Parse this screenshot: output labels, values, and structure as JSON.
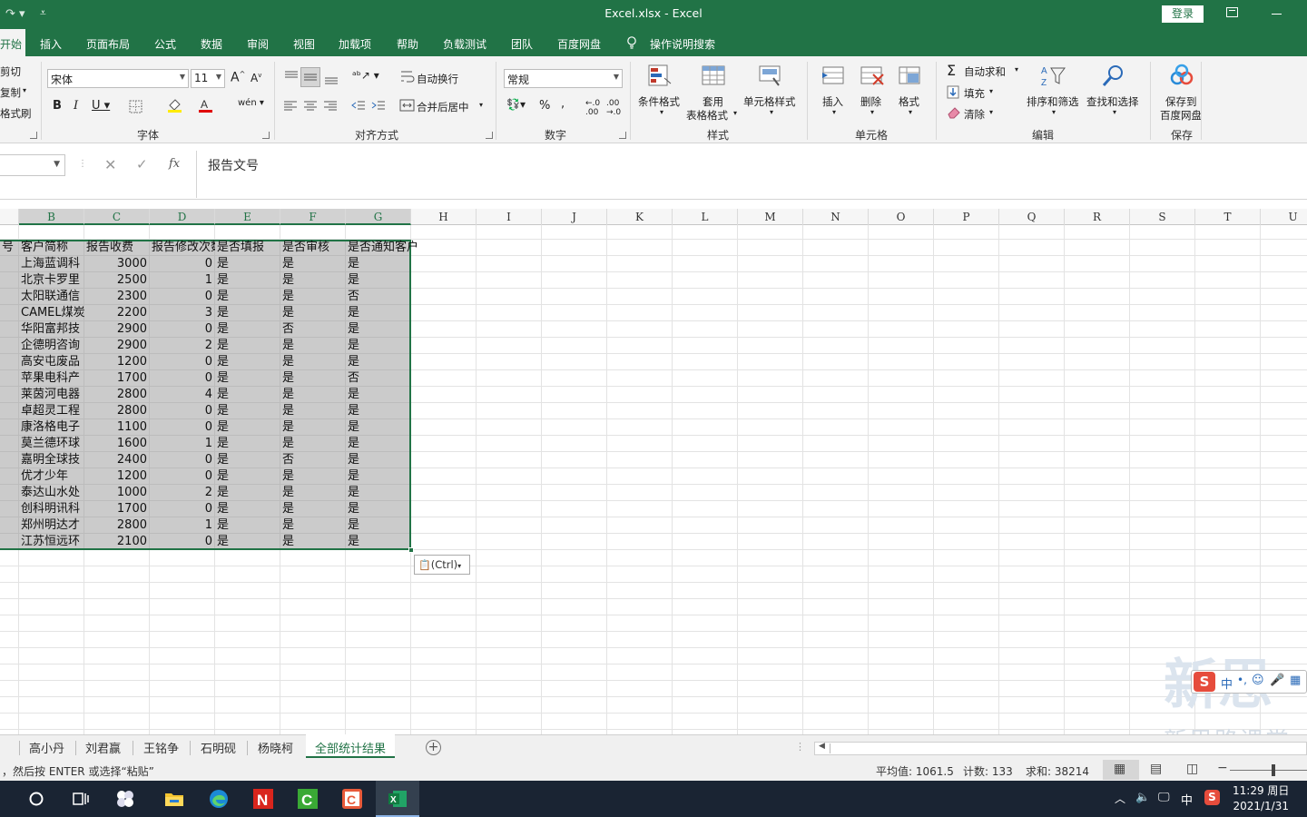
{
  "titlebar": {
    "title": "Excel.xlsx  -  Excel",
    "login_label": "登录"
  },
  "tabs": [
    "开始",
    "插入",
    "页面布局",
    "公式",
    "数据",
    "审阅",
    "视图",
    "加载项",
    "帮助",
    "负载测试",
    "团队",
    "百度网盘"
  ],
  "tell_me": "操作说明搜索",
  "ribbon": {
    "clipboard": {
      "cut": "剪切",
      "copy": "复制",
      "format_painter": "格式刷"
    },
    "font": {
      "name": "宋体",
      "size": "11",
      "group_label": "字体"
    },
    "alignment": {
      "wrap_text": "自动换行",
      "merge_center": "合并后居中",
      "group_label": "对齐方式"
    },
    "number": {
      "format": "常规",
      "group_label": "数字"
    },
    "styles": {
      "conditional": "条件格式",
      "table_line1": "套用",
      "table_line2": "表格格式",
      "cell_styles": "单元格样式",
      "group_label": "样式"
    },
    "cells": {
      "insert": "插入",
      "delete": "删除",
      "format": "格式",
      "group_label": "单元格"
    },
    "editing": {
      "autosum": "自动求和",
      "fill": "填充",
      "clear": "清除",
      "sort_filter": "排序和筛选",
      "find_select": "查找和选择",
      "group_label": "编辑"
    },
    "save": {
      "line1": "保存到",
      "line2": "百度网盘",
      "group_label": "保存"
    }
  },
  "formula_bar": {
    "content": "报告文号",
    "fx": "fx"
  },
  "columns": [
    "B",
    "C",
    "D",
    "E",
    "F",
    "G",
    "H",
    "I",
    "J",
    "K",
    "L",
    "M",
    "N",
    "O",
    "P",
    "Q",
    "R",
    "S",
    "T",
    "U"
  ],
  "table": {
    "a_header": "号",
    "headers": [
      "客户简称",
      "报告收费",
      "报告修改次数",
      "是否填报",
      "是否审核",
      "是否通知客户"
    ],
    "rows": [
      [
        "上海蓝调科",
        "3000",
        "0",
        "是",
        "是",
        "是"
      ],
      [
        "北京卡罗里",
        "2500",
        "1",
        "是",
        "是",
        "是"
      ],
      [
        "太阳联通信",
        "2300",
        "0",
        "是",
        "是",
        "否"
      ],
      [
        "CAMEL煤炭",
        "2200",
        "3",
        "是",
        "是",
        "是"
      ],
      [
        "华阳富邦技",
        "2900",
        "0",
        "是",
        "否",
        "是"
      ],
      [
        "企德明咨询",
        "2900",
        "2",
        "是",
        "是",
        "是"
      ],
      [
        "高安屯废品",
        "1200",
        "0",
        "是",
        "是",
        "是"
      ],
      [
        "苹果电科产",
        "1700",
        "0",
        "是",
        "是",
        "否"
      ],
      [
        "莱茵河电器",
        "2800",
        "4",
        "是",
        "是",
        "是"
      ],
      [
        "卓超灵工程",
        "2800",
        "0",
        "是",
        "是",
        "是"
      ],
      [
        "康洛格电子",
        "1100",
        "0",
        "是",
        "是",
        "是"
      ],
      [
        "莫兰德环球",
        "1600",
        "1",
        "是",
        "是",
        "是"
      ],
      [
        "嘉明全球技",
        "2400",
        "0",
        "是",
        "否",
        "是"
      ],
      [
        "优才少年",
        "1200",
        "0",
        "是",
        "是",
        "是"
      ],
      [
        "泰达山水处",
        "1000",
        "2",
        "是",
        "是",
        "是"
      ],
      [
        "创科明讯科",
        "1700",
        "0",
        "是",
        "是",
        "是"
      ],
      [
        "郑州明达才",
        "2800",
        "1",
        "是",
        "是",
        "是"
      ],
      [
        "江苏恒远环",
        "2100",
        "0",
        "是",
        "是",
        "是"
      ]
    ]
  },
  "paste_options": "(Ctrl)",
  "sheet_tabs": [
    "高小丹",
    "刘君赢",
    "王铭争",
    "石明砚",
    "杨晓柯",
    "全部统计结果"
  ],
  "active_sheet": "全部统计结果",
  "status": {
    "message": "，然后按 ENTER 或选择“粘贴”",
    "average": "平均值: 1061.5",
    "count": "计数: 133",
    "sum": "求和: 38214"
  },
  "taskbar": {
    "time": "11:29 周日",
    "date": "2021/1/31",
    "ime": "中"
  },
  "ime_bar": {
    "mode": "中"
  },
  "watermark": "新思路课堂",
  "colors": {
    "excel_green": "#217346",
    "taskbar": "#1a2433"
  }
}
